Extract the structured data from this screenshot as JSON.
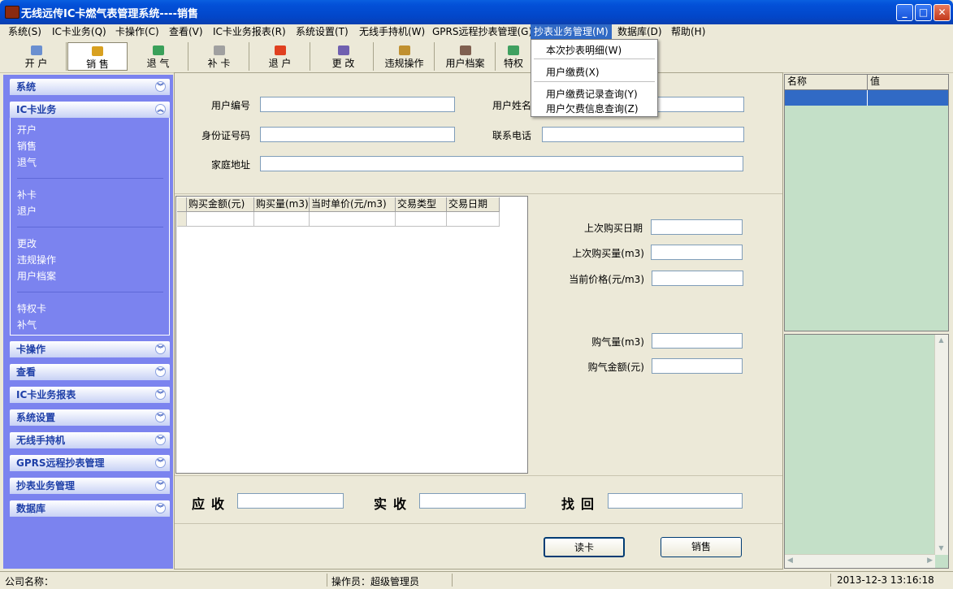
{
  "window": {
    "title": "无线远传IC卡燃气表管理系统----销售"
  },
  "menubar": [
    "系统(S)",
    "IC卡业务(Q)",
    "卡操作(C)",
    "查看(V)",
    "IC卡业务报表(R)",
    "系统设置(T)",
    "无线手持机(W)",
    "GPRS远程抄表管理(G)",
    "抄表业务管理(M)",
    "数据库(D)",
    "帮助(H)"
  ],
  "toolbar": [
    "开 户",
    "销 售",
    "退 气",
    "补 卡",
    "退 户",
    "更 改",
    "违规操作",
    "用户档案",
    "特权"
  ],
  "dropdown": [
    "本次抄表明细(W)",
    "用户缴费(X)",
    "用户缴费记录查询(Y)",
    "用户欠费信息查询(Z)"
  ],
  "nav": {
    "sections_top": [
      "系统",
      "IC卡业务"
    ],
    "ic_items": [
      "开户",
      "销售",
      "退气",
      "补卡",
      "退户",
      "更改",
      "违规操作",
      "用户档案",
      "特权卡",
      "补气"
    ],
    "sections_bottom": [
      "卡操作",
      "查看",
      "IC卡业务报表",
      "系统设置",
      "无线手持机",
      "GPRS远程抄表管理",
      "抄表业务管理",
      "数据库"
    ]
  },
  "form": {
    "user_no": "用户编号",
    "user_name": "用户姓名",
    "id_no": "身份证号码",
    "phone": "联系电话",
    "address": "家庭地址"
  },
  "grid": {
    "columns": [
      "购买金额(元)",
      "购买量(m3)",
      "当时单价(元/m3)",
      "交易类型",
      "交易日期"
    ]
  },
  "info": {
    "last_date": "上次购买日期",
    "last_qty": "上次购买量(m3)",
    "cur_price": "当前价格(元/m3)",
    "buy_qty": "购气量(m3)",
    "buy_amount": "购气金额(元)"
  },
  "totals": {
    "receivable": "应收",
    "received": "实收",
    "change": "找回"
  },
  "buttons": {
    "read_card": "读卡",
    "sell": "销售"
  },
  "props": {
    "col_name": "名称",
    "col_value": "值"
  },
  "status": {
    "company": "公司名称：",
    "operator": "操作员：超级管理员",
    "datetime": "2013-12-3  13:16:18"
  }
}
